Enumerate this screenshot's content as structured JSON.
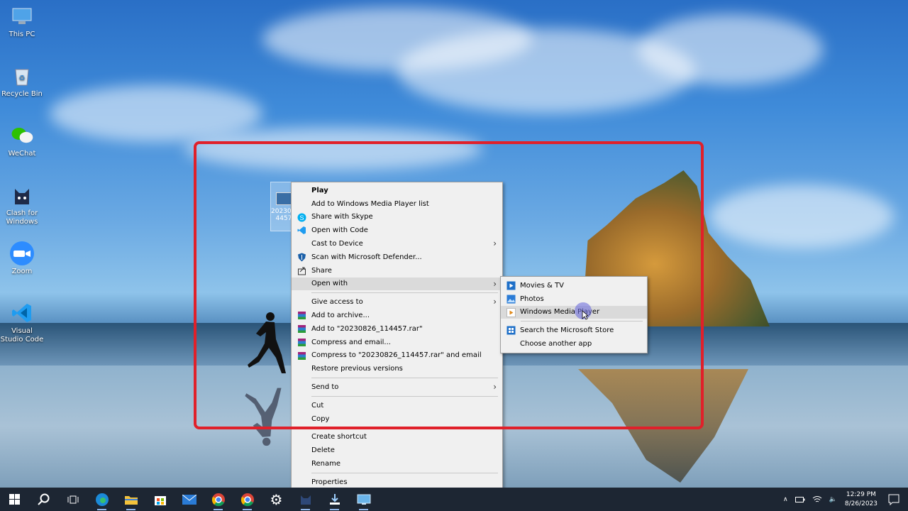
{
  "desktop": {
    "icons": [
      {
        "label": "This PC"
      },
      {
        "label": "Recycle Bin"
      },
      {
        "label": "WeChat"
      },
      {
        "label": "Clash for Windows"
      },
      {
        "label": "Zoom"
      },
      {
        "label": "Visual Studio Code"
      }
    ],
    "selected_file_label": "20230... 4457"
  },
  "context_menu": {
    "items": [
      {
        "label": "Play",
        "bold": true
      },
      {
        "label": "Add to Windows Media Player list"
      },
      {
        "label": "Share with Skype",
        "icon": "skype-icon"
      },
      {
        "label": "Open with Code",
        "icon": "vscode-icon"
      },
      {
        "label": "Cast to Device",
        "submenu": true
      },
      {
        "label": "Scan with Microsoft Defender...",
        "icon": "defender-icon"
      },
      {
        "label": "Share",
        "icon": "share-icon"
      },
      {
        "label": "Open with",
        "submenu": true,
        "active": true
      },
      {
        "label": "Give access to",
        "submenu": true
      },
      {
        "label": "Add to archive...",
        "icon": "winrar-icon"
      },
      {
        "label": "Add to \"20230826_114457.rar\"",
        "icon": "winrar-icon"
      },
      {
        "label": "Compress and email...",
        "icon": "winrar-icon"
      },
      {
        "label": "Compress to \"20230826_114457.rar\" and email",
        "icon": "winrar-icon"
      },
      {
        "label": "Restore previous versions"
      },
      {
        "label": "Send to",
        "submenu": true
      },
      {
        "label": "Cut"
      },
      {
        "label": "Copy"
      },
      {
        "label": "Create shortcut"
      },
      {
        "label": "Delete"
      },
      {
        "label": "Rename"
      },
      {
        "label": "Properties"
      }
    ]
  },
  "open_with_submenu": {
    "items": [
      {
        "label": "Movies & TV",
        "icon": "movies-tv-icon"
      },
      {
        "label": "Photos",
        "icon": "photos-icon"
      },
      {
        "label": "Windows Media Player",
        "icon": "media-player-icon",
        "hover": true
      },
      {
        "label": "Search the Microsoft Store",
        "icon": "store-icon"
      },
      {
        "label": "Choose another app"
      }
    ]
  },
  "taskbar": {
    "time": "12:29 PM",
    "date": "8/26/2023"
  },
  "colors": {
    "highlight_frame": "#e0202a",
    "taskbar": "#1d2633",
    "menu_bg": "#f0f0f0"
  }
}
